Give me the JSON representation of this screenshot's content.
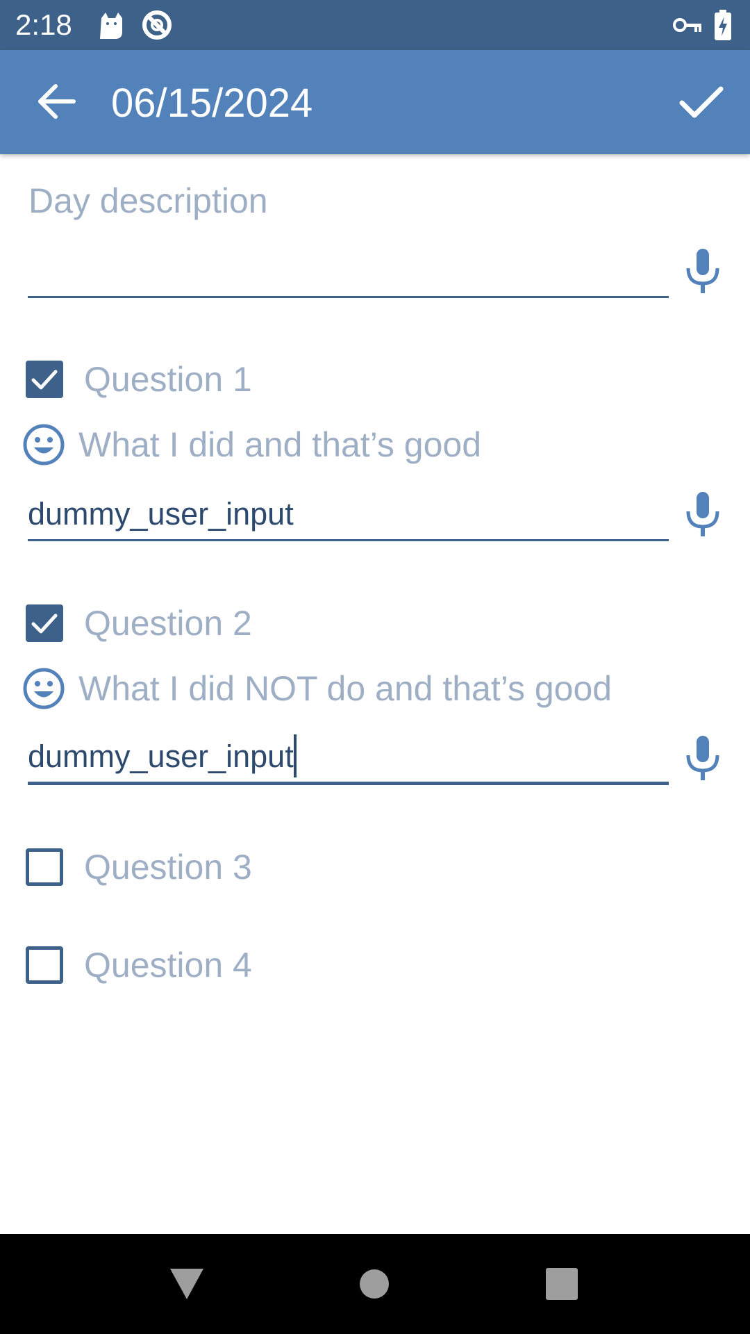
{
  "status_bar": {
    "time": "2:18",
    "icons": [
      "cat-notification-icon",
      "do-not-disturb-icon",
      "vpn-key-icon",
      "battery-charging-icon"
    ]
  },
  "app_bar": {
    "title": "06/15/2024",
    "back_icon": "arrow-left-icon",
    "save_icon": "check-icon"
  },
  "day_description": {
    "label": "Day description",
    "value": "",
    "mic_icon": "microphone-icon"
  },
  "questions": [
    {
      "label": "Question 1",
      "checked": true,
      "prompt": "What I did and that’s good",
      "prompt_icon": "smiley-icon",
      "answer": "dummy_user_input",
      "focused": false
    },
    {
      "label": "Question 2",
      "checked": true,
      "prompt": "What I did NOT do and that’s good",
      "prompt_icon": "smiley-icon",
      "answer": "dummy_user_input",
      "focused": true
    },
    {
      "label": "Question 3",
      "checked": false
    },
    {
      "label": "Question 4",
      "checked": false
    }
  ],
  "nav_bar": {
    "back_icon": "nav-back-triangle-icon",
    "home_icon": "nav-home-circle-icon",
    "recents_icon": "nav-recents-square-icon"
  },
  "colors": {
    "status_bar": "#3d6188",
    "app_bar": "#5381ba",
    "accent": "#3d6188",
    "hint_text": "#9eafc5",
    "input_text": "#2d4a6e",
    "icon_blue": "#5381ba"
  }
}
